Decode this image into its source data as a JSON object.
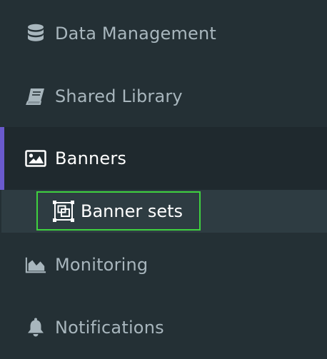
{
  "sidebar": {
    "items": [
      {
        "label": "Data Management",
        "icon": "database-icon"
      },
      {
        "label": "Shared Library",
        "icon": "book-icon"
      },
      {
        "label": "Banners",
        "icon": "image-icon",
        "active": true
      },
      {
        "label": "Monitoring",
        "icon": "area-chart-icon"
      },
      {
        "label": "Notifications",
        "icon": "bell-icon"
      }
    ],
    "subitems": [
      {
        "label": "Banner sets",
        "icon": "object-group-icon",
        "focused": true
      }
    ]
  },
  "colors": {
    "background": "#243035",
    "active_background": "#1f292e",
    "subitem_background": "#2e3c42",
    "active_indicator": "#6a5acd",
    "focus_outline": "#3fd13f",
    "text_muted": "#a8b6bd",
    "text_active": "#ffffff"
  }
}
